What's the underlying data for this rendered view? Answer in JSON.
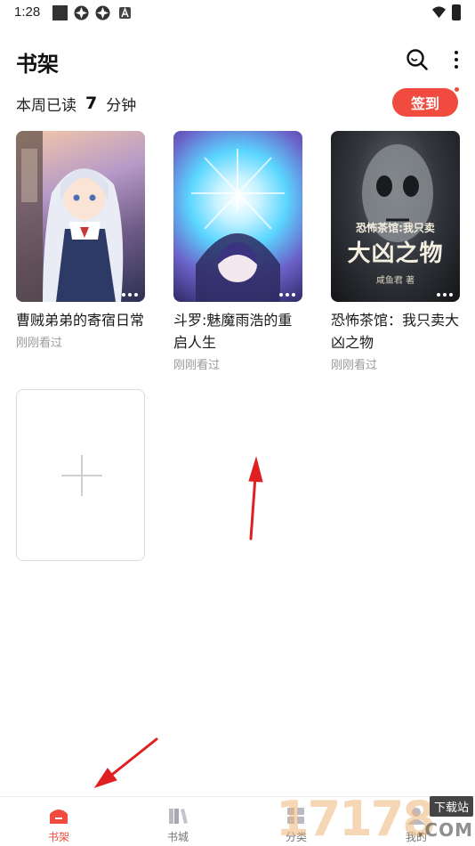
{
  "status_bar": {
    "time": "1:28",
    "icons": [
      "square-icon",
      "disc-icon",
      "disc-icon",
      "a-icon",
      "wifi-icon",
      "battery-icon"
    ]
  },
  "header": {
    "title": "书架",
    "search_icon": "search-icon",
    "more_icon": "more-vertical-icon"
  },
  "stats": {
    "prefix": "本周已读",
    "value": "7",
    "unit": "分钟"
  },
  "checkin": {
    "label": "签到",
    "color": "#f04b3e"
  },
  "books": [
    {
      "title": "曹贼弟弟的寄宿日常",
      "subtitle": "刚刚看过"
    },
    {
      "title": "斗罗:魅魔雨浩的重启人生",
      "subtitle": "刚刚看过"
    },
    {
      "title": "恐怖茶馆：我只卖大凶之物",
      "subtitle": "刚刚看过",
      "cover_text_top": "恐怖茶馆:我只卖",
      "cover_text_main": "大凶之物",
      "cover_author": "咸鱼君 著"
    }
  ],
  "add_tile": {
    "icon": "plus-icon"
  },
  "bottom_nav": [
    {
      "label": "书架",
      "icon": "bookshelf-icon",
      "active": true
    },
    {
      "label": "书城",
      "icon": "bookstore-icon",
      "active": false
    },
    {
      "label": "分类",
      "icon": "category-icon",
      "active": false
    },
    {
      "label": "我的",
      "icon": "profile-icon",
      "active": false
    }
  ],
  "watermark": {
    "digits": "17178",
    "badge": "下载站",
    "suffix": ".COM"
  },
  "colors": {
    "accent": "#f04b3e",
    "annotation_arrow": "#e02020"
  }
}
